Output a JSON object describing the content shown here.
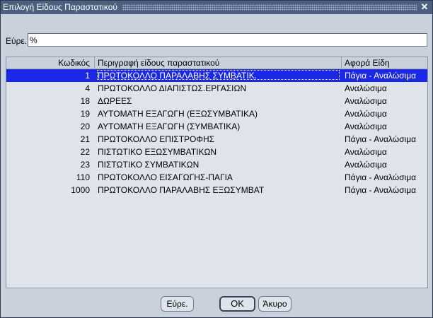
{
  "window": {
    "title": "Επιλογή Είδους Παραστατικού",
    "close_glyph": "✕"
  },
  "find": {
    "label": "Εύρε.",
    "value": "%"
  },
  "list": {
    "columns": {
      "code": "Κωδικός",
      "description": "Περιγραφή είδους παραστατικού",
      "type": "Αφορά Είδη"
    },
    "rows": [
      {
        "code": "1",
        "description": "ΠΡΩΤΟΚΟΛΛΟ ΠΑΡΑΛΑΒΗΣ ΣΥΜΒΑΤΙΚ.",
        "type": "Πάγια - Αναλώσιμα"
      },
      {
        "code": "4",
        "description": "ΠΡΩΤΟΚΟΛΛΟ ΔΙΑΠΙΣΤΩΣ.ΕΡΓΑΣΙΩΝ",
        "type": "Αναλώσιμα"
      },
      {
        "code": "18",
        "description": "ΔΩΡΕΕΣ",
        "type": "Αναλώσιμα"
      },
      {
        "code": "19",
        "description": "ΑΥΤΟΜΑΤΗ ΕΞΑΓΩΓΗ (ΕΞΩΣΥΜΒΑΤΙΚΑ)",
        "type": "Αναλώσιμα"
      },
      {
        "code": "20",
        "description": "ΑΥΤΟΜΑΤΗ ΕΞΑΓΩΓΗ (ΣΥΜΒΑΤΙΚΑ)",
        "type": "Αναλώσιμα"
      },
      {
        "code": "21",
        "description": "ΠΡΩΤΟΚΟΛΛΟ ΕΠΙΣΤΡΟΦΗΣ",
        "type": "Πάγια - Αναλώσιμα"
      },
      {
        "code": "22",
        "description": "ΠΙΣΤΩΤΙΚΟ ΕΞΩΣΥΜΒΑΤΙΚΩΝ",
        "type": "Αναλώσιμα"
      },
      {
        "code": "23",
        "description": "ΠΙΣΤΩΤΙΚΟ ΣΥΜΒΑΤΙΚΩΝ",
        "type": "Αναλώσιμα"
      },
      {
        "code": "110",
        "description": "ΠΡΩΤΟΚΟΛΛΟ ΕΙΣΑΓΩΓΗΣ-ΠΑΓΙΑ",
        "type": "Πάγια - Αναλώσιμα"
      },
      {
        "code": "1000",
        "description": "ΠΡΩΤΟΚΟΛΛΟ ΠΑΡΑΛΑΒΗΣ ΕΞΩΣΥΜΒΑΤ",
        "type": "Πάγια - Αναλώσιμα"
      }
    ]
  },
  "buttons": {
    "find": "Εύρε.",
    "ok": "OK",
    "cancel": "Άκυρο"
  }
}
